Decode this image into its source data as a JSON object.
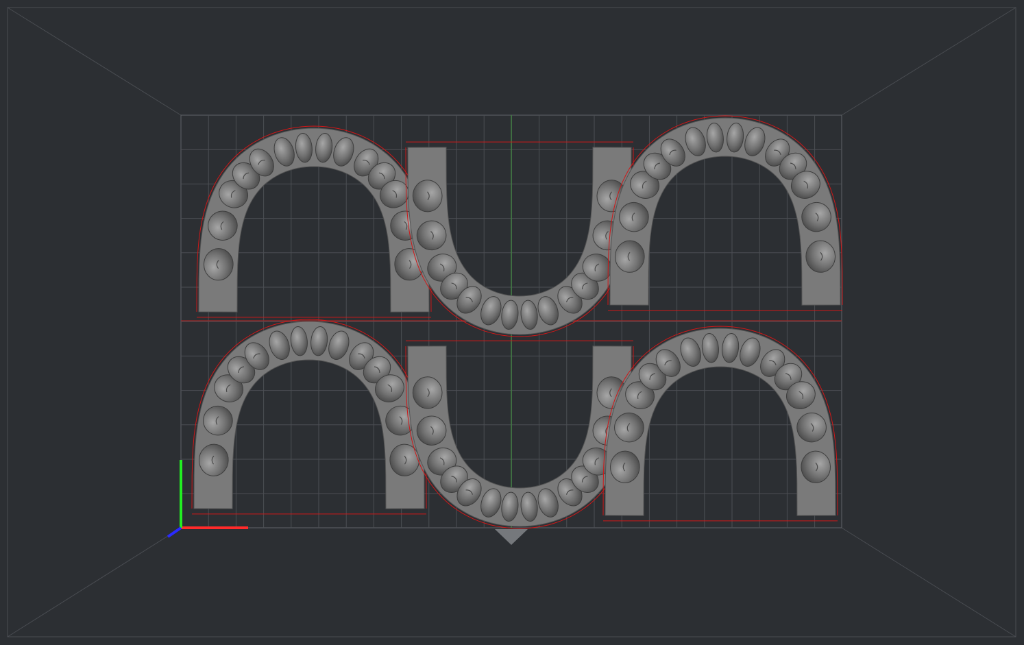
{
  "viewport": {
    "background": "#2c2f33",
    "build_volume_edge_color": "#4a4d52",
    "grid_line_color": "#4c4f54",
    "grid_major_line_color": "#585b60"
  },
  "axes": {
    "x_axis_color": "#ff2a2a",
    "y_axis_color": "#22ee22",
    "z_axis_color": "#2a2aff",
    "center_x_line_color": "#3f8a3f",
    "center_y_line_color": "#a02a2a"
  },
  "models": {
    "count": 6,
    "material_color": "#7a7a7a",
    "highlight_color": "#9a9a9a",
    "support_outline_color": "#d01818",
    "items": [
      {
        "id": "arch-1",
        "orientation": "up"
      },
      {
        "id": "arch-2",
        "orientation": "down"
      },
      {
        "id": "arch-3",
        "orientation": "up"
      },
      {
        "id": "arch-4",
        "orientation": "up"
      },
      {
        "id": "arch-5",
        "orientation": "down"
      },
      {
        "id": "arch-6",
        "orientation": "up"
      }
    ]
  },
  "front_marker": {
    "icon": "triangle-down-icon",
    "color": "#75787c"
  }
}
